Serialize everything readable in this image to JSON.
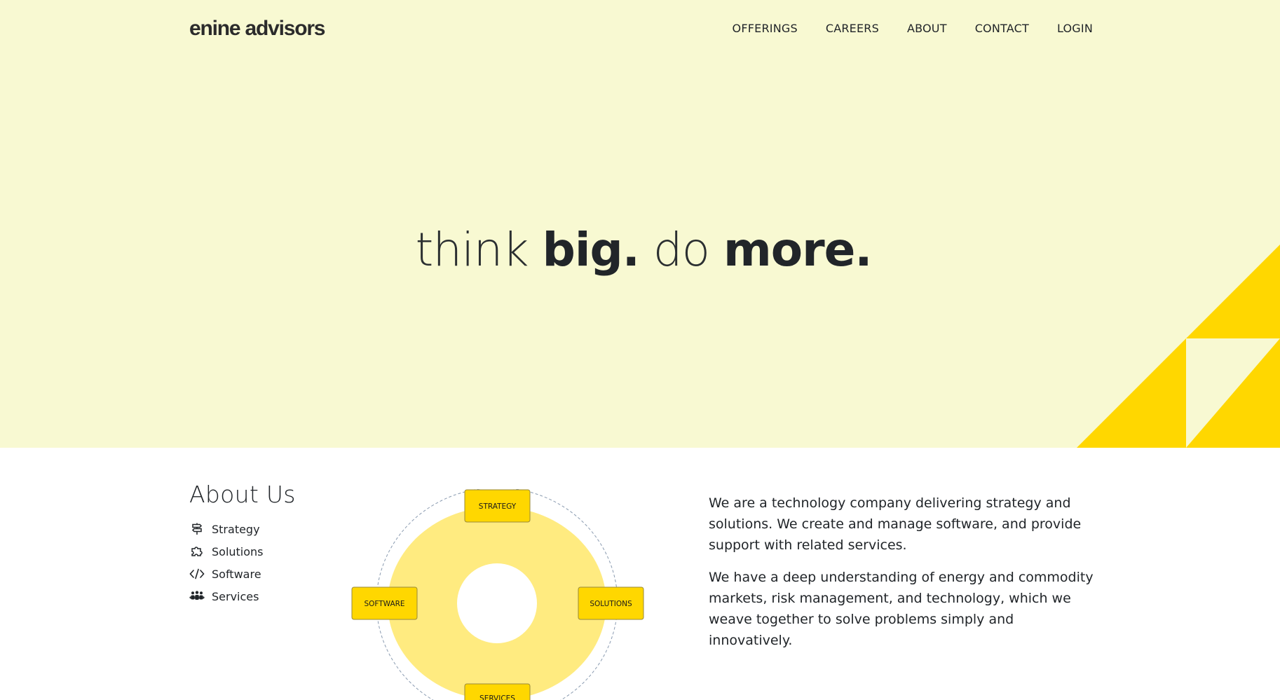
{
  "brand": {
    "name": "enine advisors"
  },
  "nav": {
    "items": [
      {
        "label": "OFFERINGS"
      },
      {
        "label": "CAREERS"
      },
      {
        "label": "ABOUT"
      },
      {
        "label": "CONTACT"
      },
      {
        "label": "LOGIN"
      }
    ]
  },
  "hero": {
    "tagline_think": "think ",
    "tagline_big": "big.",
    "tagline_do": " do ",
    "tagline_more": "more."
  },
  "about": {
    "title": "About Us",
    "items": [
      {
        "label": "Strategy",
        "icon": "signpost-icon"
      },
      {
        "label": "Solutions",
        "icon": "puzzle-icon"
      },
      {
        "label": "Software",
        "icon": "code-icon"
      },
      {
        "label": "Services",
        "icon": "people-icon"
      }
    ],
    "diagram": {
      "top": "STRATEGY",
      "right": "SOLUTIONS",
      "bottom": "SERVICES",
      "left": "SOFTWARE"
    },
    "paragraphs": [
      "We are a technology company delivering strategy and solutions. We create and manage software, and provide support with related services.",
      "We have a deep understanding of energy and commodity markets, risk management, and technology, which we weave together to solve problems simply and innovatively."
    ]
  },
  "colors": {
    "hero_bg": "#f8f9d2",
    "accent": "#ffd700",
    "ring": "#ffeb80"
  }
}
